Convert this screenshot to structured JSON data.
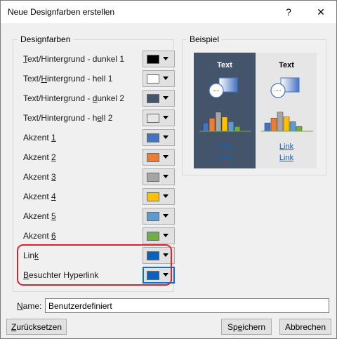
{
  "window": {
    "title": "Neue Designfarben erstellen",
    "help_label": "?",
    "close_label": "✕"
  },
  "colors_group": {
    "legend": "Designfarben",
    "rows": [
      {
        "pre": "",
        "key": "T",
        "post": "ext/Hintergrund - dunkel 1",
        "swatch": "#000000"
      },
      {
        "pre": "Text/",
        "key": "H",
        "post": "intergrund - hell 1",
        "swatch": "#ffffff"
      },
      {
        "pre": "Text/Hintergrund - ",
        "key": "d",
        "post": "unkel 2",
        "swatch": "#44546a"
      },
      {
        "pre": "Text/Hintergrund - h",
        "key": "e",
        "post": "ll 2",
        "swatch": "#e7e6e6"
      },
      {
        "pre": "Akzent ",
        "key": "1",
        "post": "",
        "swatch": "#4472c4"
      },
      {
        "pre": "Akzent ",
        "key": "2",
        "post": "",
        "swatch": "#ed7d31"
      },
      {
        "pre": "Akzent ",
        "key": "3",
        "post": "",
        "swatch": "#a5a5a5"
      },
      {
        "pre": "Akzent ",
        "key": "4",
        "post": "",
        "swatch": "#ffc000"
      },
      {
        "pre": "Akzent ",
        "key": "5",
        "post": "",
        "swatch": "#5b9bd5"
      },
      {
        "pre": "Akzent ",
        "key": "6",
        "post": "",
        "swatch": "#70ad47"
      },
      {
        "pre": "Lin",
        "key": "k",
        "post": "",
        "swatch": "#0563c1"
      },
      {
        "pre": "",
        "key": "B",
        "post": "esuchter Hyperlink",
        "swatch": "#0563c1"
      }
    ],
    "highlight_color": "#e0202e"
  },
  "sample_group": {
    "legend": "Beispiel",
    "dark": {
      "text": "Text",
      "link1": "Link",
      "link2": "Link",
      "bg": "#44546a",
      "text_color": "#ffffff",
      "link_color": "#0563c1"
    },
    "light": {
      "text": "Text",
      "link1": "Link",
      "link2": "Link",
      "bg": "#e7e6e6",
      "text_color": "#000000",
      "link_color": "#0563c1"
    },
    "bar_colors": [
      "#4472c4",
      "#ed7d31",
      "#a5a5a5",
      "#ffc000",
      "#5b9bd5",
      "#70ad47"
    ],
    "bar_values": [
      0.35,
      0.55,
      0.8,
      0.6,
      0.4,
      0.2
    ]
  },
  "name_field": {
    "label_key": "N",
    "label_rest": "ame:",
    "value": "Benutzerdefiniert"
  },
  "buttons": {
    "reset_key": "Z",
    "reset_rest": "urücksetzen",
    "save_pre": "Sp",
    "save_key": "e",
    "save_post": "ichern",
    "cancel": "Abbrechen"
  }
}
